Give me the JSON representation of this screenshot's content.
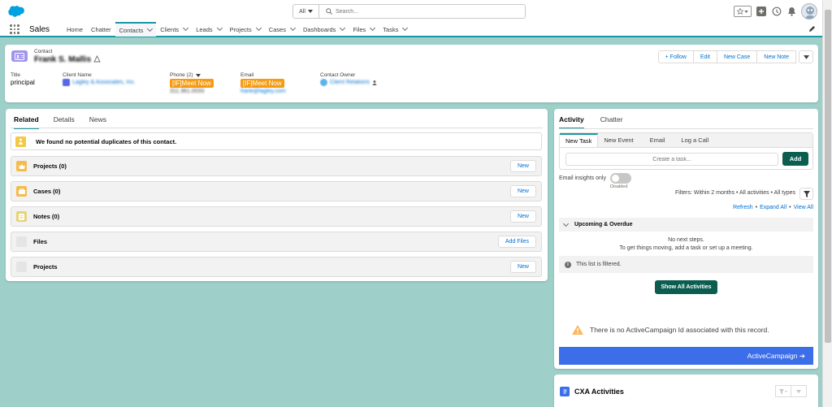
{
  "header": {
    "search_scope": "All",
    "search_placeholder": "Search..."
  },
  "nav": {
    "app_name": "Sales",
    "items": [
      {
        "label": "Home",
        "dropdown": false
      },
      {
        "label": "Chatter",
        "dropdown": false
      },
      {
        "label": "Contacts",
        "dropdown": true,
        "active": true
      },
      {
        "label": "Clients",
        "dropdown": true
      },
      {
        "label": "Leads",
        "dropdown": true
      },
      {
        "label": "Projects",
        "dropdown": true
      },
      {
        "label": "Cases",
        "dropdown": true
      },
      {
        "label": "Dashboards",
        "dropdown": true
      },
      {
        "label": "Files",
        "dropdown": true
      },
      {
        "label": "Tasks",
        "dropdown": true
      }
    ]
  },
  "record": {
    "kind": "Contact",
    "name": "Frank S. Mallis",
    "actions": {
      "follow": "+ Follow",
      "edit": "Edit",
      "new_case": "New Case",
      "new_note": "New Note"
    },
    "fields": {
      "title_label": "Title",
      "title_value": "principal",
      "client_label": "Client Name",
      "client_value": "Lagley & Associates, Inc.",
      "phone_label": "Phone (2)",
      "phone_meet": "[IF]Meet Now",
      "phone_value": "311.361.0033",
      "email_label": "Email",
      "email_meet": "[IF]Meet Now",
      "email_value": "frank@lagley.com",
      "owner_label": "Contact Owner",
      "owner_value": "Client Relations"
    }
  },
  "related": {
    "tabs": [
      "Related",
      "Details",
      "News"
    ],
    "duplicates": "We found no potential duplicates of this contact.",
    "lists": [
      {
        "title": "Projects (0)",
        "button": "New",
        "icon_color": "#f4bc4c"
      },
      {
        "title": "Cases (0)",
        "button": "New",
        "icon_color": "#f4bc4c"
      },
      {
        "title": "Notes (0)",
        "button": "New",
        "icon_color": "#e6d478"
      },
      {
        "title": "Files",
        "button": "Add Files",
        "icon_color": "#e5e5e5"
      },
      {
        "title": "Projects",
        "button": "New",
        "icon_color": "#e5e5e5"
      }
    ]
  },
  "activity": {
    "tabs": [
      "Activity",
      "Chatter"
    ],
    "publisher_tabs": [
      "New Task",
      "New Event",
      "Email",
      "Log a Call"
    ],
    "task_placeholder": "Create a task...",
    "add_label": "Add",
    "email_insights": "Email insights only",
    "toggle_state": "Disabled",
    "filters": "Filters: Within 2 months • All activities • All types",
    "links": [
      "Refresh",
      "Expand All",
      "View All"
    ],
    "upcoming": "Upcoming & Overdue",
    "no_next_1": "No next steps.",
    "no_next_2": "To get things moving, add a task or set up a meeting.",
    "filtered": "This list is filtered.",
    "show_all": "Show All Activities",
    "ac_warning": "There is no ActiveCampaign Id associated with this record.",
    "ac_button": "ActiveCampaign ➔"
  },
  "cxa": {
    "title": "CXA Activities"
  }
}
